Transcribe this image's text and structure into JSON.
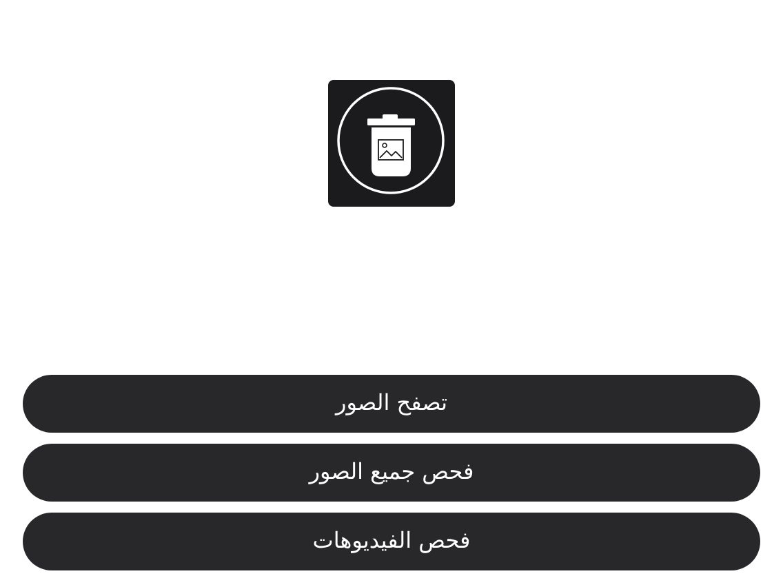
{
  "app_icon": {
    "icon": "trash-photo-icon",
    "background": "#1b1b1d",
    "foreground": "#ffffff"
  },
  "actions": {
    "browse_photos_label": "تصفح الصور",
    "scan_all_photos_label": "فحص جميع الصور",
    "scan_videos_label": "فحص الفيديوهات"
  },
  "colors": {
    "page_background": "#ffffff",
    "button_background": "#28272a",
    "button_text": "#ffffff"
  }
}
